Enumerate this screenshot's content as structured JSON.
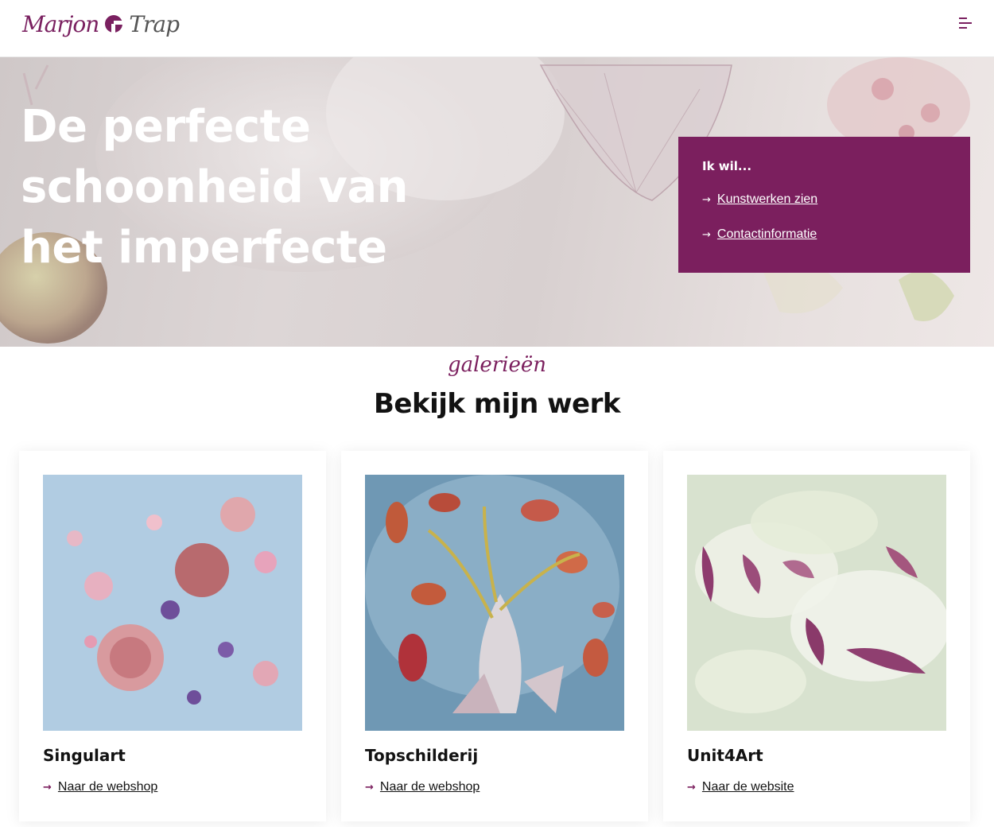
{
  "header": {
    "logo_first": "Marjon",
    "logo_second": "Trap",
    "menu_icon": "hamburger-menu-icon"
  },
  "hero": {
    "title_line1": "De perfecte",
    "title_line2": "schoonheid van",
    "title_line3": "het imperfecte",
    "box_title": "Ik wil...",
    "links": [
      {
        "label": "Kunstwerken zien"
      },
      {
        "label": "Contactinformatie"
      }
    ]
  },
  "galleries": {
    "kicker": "galerieën",
    "title": "Bekijk mijn werk",
    "cards": [
      {
        "name": "Singulart",
        "link": "Naar de webshop"
      },
      {
        "name": "Topschilderij",
        "link": "Naar de webshop"
      },
      {
        "name": "Unit4Art",
        "link": "Naar de website"
      }
    ]
  },
  "colors": {
    "accent": "#7b1f5e",
    "text": "#121212",
    "background": "#ffffff"
  }
}
